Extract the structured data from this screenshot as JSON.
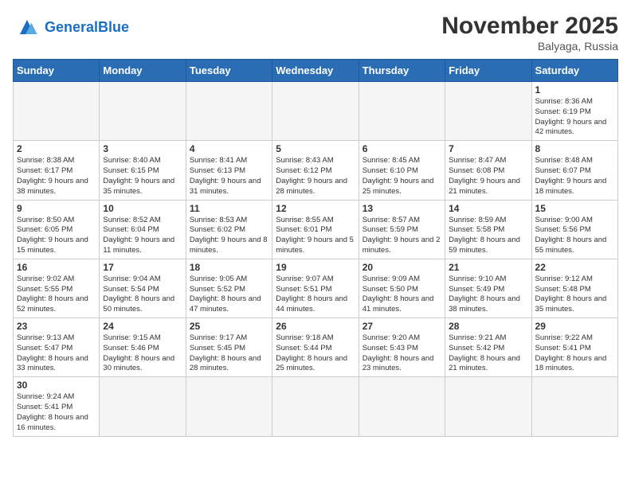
{
  "logo": {
    "general": "General",
    "blue": "Blue"
  },
  "header": {
    "month_year": "November 2025",
    "location": "Balyaga, Russia"
  },
  "weekdays": [
    "Sunday",
    "Monday",
    "Tuesday",
    "Wednesday",
    "Thursday",
    "Friday",
    "Saturday"
  ],
  "weeks": [
    [
      {
        "day": "",
        "info": ""
      },
      {
        "day": "",
        "info": ""
      },
      {
        "day": "",
        "info": ""
      },
      {
        "day": "",
        "info": ""
      },
      {
        "day": "",
        "info": ""
      },
      {
        "day": "",
        "info": ""
      },
      {
        "day": "1",
        "info": "Sunrise: 8:36 AM\nSunset: 6:19 PM\nDaylight: 9 hours and 42 minutes."
      }
    ],
    [
      {
        "day": "2",
        "info": "Sunrise: 8:38 AM\nSunset: 6:17 PM\nDaylight: 9 hours and 38 minutes."
      },
      {
        "day": "3",
        "info": "Sunrise: 8:40 AM\nSunset: 6:15 PM\nDaylight: 9 hours and 35 minutes."
      },
      {
        "day": "4",
        "info": "Sunrise: 8:41 AM\nSunset: 6:13 PM\nDaylight: 9 hours and 31 minutes."
      },
      {
        "day": "5",
        "info": "Sunrise: 8:43 AM\nSunset: 6:12 PM\nDaylight: 9 hours and 28 minutes."
      },
      {
        "day": "6",
        "info": "Sunrise: 8:45 AM\nSunset: 6:10 PM\nDaylight: 9 hours and 25 minutes."
      },
      {
        "day": "7",
        "info": "Sunrise: 8:47 AM\nSunset: 6:08 PM\nDaylight: 9 hours and 21 minutes."
      },
      {
        "day": "8",
        "info": "Sunrise: 8:48 AM\nSunset: 6:07 PM\nDaylight: 9 hours and 18 minutes."
      }
    ],
    [
      {
        "day": "9",
        "info": "Sunrise: 8:50 AM\nSunset: 6:05 PM\nDaylight: 9 hours and 15 minutes."
      },
      {
        "day": "10",
        "info": "Sunrise: 8:52 AM\nSunset: 6:04 PM\nDaylight: 9 hours and 11 minutes."
      },
      {
        "day": "11",
        "info": "Sunrise: 8:53 AM\nSunset: 6:02 PM\nDaylight: 9 hours and 8 minutes."
      },
      {
        "day": "12",
        "info": "Sunrise: 8:55 AM\nSunset: 6:01 PM\nDaylight: 9 hours and 5 minutes."
      },
      {
        "day": "13",
        "info": "Sunrise: 8:57 AM\nSunset: 5:59 PM\nDaylight: 9 hours and 2 minutes."
      },
      {
        "day": "14",
        "info": "Sunrise: 8:59 AM\nSunset: 5:58 PM\nDaylight: 8 hours and 59 minutes."
      },
      {
        "day": "15",
        "info": "Sunrise: 9:00 AM\nSunset: 5:56 PM\nDaylight: 8 hours and 55 minutes."
      }
    ],
    [
      {
        "day": "16",
        "info": "Sunrise: 9:02 AM\nSunset: 5:55 PM\nDaylight: 8 hours and 52 minutes."
      },
      {
        "day": "17",
        "info": "Sunrise: 9:04 AM\nSunset: 5:54 PM\nDaylight: 8 hours and 50 minutes."
      },
      {
        "day": "18",
        "info": "Sunrise: 9:05 AM\nSunset: 5:52 PM\nDaylight: 8 hours and 47 minutes."
      },
      {
        "day": "19",
        "info": "Sunrise: 9:07 AM\nSunset: 5:51 PM\nDaylight: 8 hours and 44 minutes."
      },
      {
        "day": "20",
        "info": "Sunrise: 9:09 AM\nSunset: 5:50 PM\nDaylight: 8 hours and 41 minutes."
      },
      {
        "day": "21",
        "info": "Sunrise: 9:10 AM\nSunset: 5:49 PM\nDaylight: 8 hours and 38 minutes."
      },
      {
        "day": "22",
        "info": "Sunrise: 9:12 AM\nSunset: 5:48 PM\nDaylight: 8 hours and 35 minutes."
      }
    ],
    [
      {
        "day": "23",
        "info": "Sunrise: 9:13 AM\nSunset: 5:47 PM\nDaylight: 8 hours and 33 minutes."
      },
      {
        "day": "24",
        "info": "Sunrise: 9:15 AM\nSunset: 5:46 PM\nDaylight: 8 hours and 30 minutes."
      },
      {
        "day": "25",
        "info": "Sunrise: 9:17 AM\nSunset: 5:45 PM\nDaylight: 8 hours and 28 minutes."
      },
      {
        "day": "26",
        "info": "Sunrise: 9:18 AM\nSunset: 5:44 PM\nDaylight: 8 hours and 25 minutes."
      },
      {
        "day": "27",
        "info": "Sunrise: 9:20 AM\nSunset: 5:43 PM\nDaylight: 8 hours and 23 minutes."
      },
      {
        "day": "28",
        "info": "Sunrise: 9:21 AM\nSunset: 5:42 PM\nDaylight: 8 hours and 21 minutes."
      },
      {
        "day": "29",
        "info": "Sunrise: 9:22 AM\nSunset: 5:41 PM\nDaylight: 8 hours and 18 minutes."
      }
    ],
    [
      {
        "day": "30",
        "info": "Sunrise: 9:24 AM\nSunset: 5:41 PM\nDaylight: 8 hours and 16 minutes."
      },
      {
        "day": "",
        "info": ""
      },
      {
        "day": "",
        "info": ""
      },
      {
        "day": "",
        "info": ""
      },
      {
        "day": "",
        "info": ""
      },
      {
        "day": "",
        "info": ""
      },
      {
        "day": "",
        "info": ""
      }
    ]
  ]
}
